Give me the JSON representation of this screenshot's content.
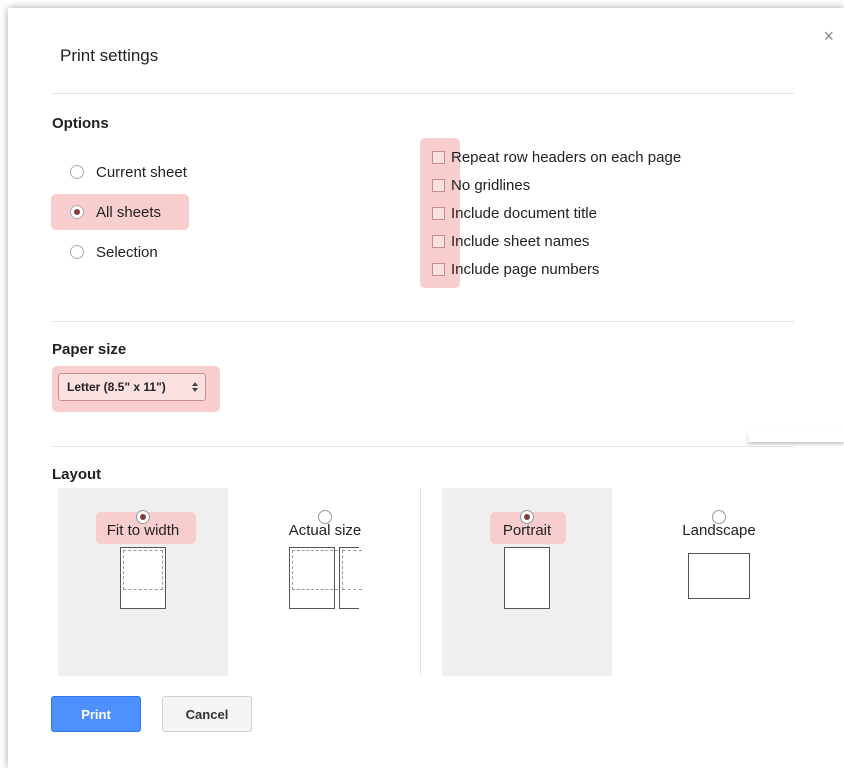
{
  "dialog": {
    "title": "Print settings",
    "close_glyph": "×"
  },
  "options": {
    "heading": "Options",
    "scope": [
      {
        "label": "Current sheet",
        "checked": false
      },
      {
        "label": "All sheets",
        "checked": true
      },
      {
        "label": "Selection",
        "checked": false
      }
    ],
    "checkboxes": [
      {
        "label": "Repeat row headers on each page",
        "checked": false
      },
      {
        "label": "No gridlines",
        "checked": false
      },
      {
        "label": "Include document title",
        "checked": false
      },
      {
        "label": "Include sheet names",
        "checked": false
      },
      {
        "label": "Include page numbers",
        "checked": false
      }
    ]
  },
  "paper": {
    "heading": "Paper size",
    "selected": "Letter (8.5\" x 11\")"
  },
  "layout": {
    "heading": "Layout",
    "scale": [
      {
        "label": "Fit to width",
        "checked": true
      },
      {
        "label": "Actual size",
        "checked": false
      }
    ],
    "orientation": [
      {
        "label": "Portrait",
        "checked": true
      },
      {
        "label": "Landscape",
        "checked": false
      }
    ]
  },
  "buttons": {
    "print": "Print",
    "cancel": "Cancel"
  },
  "colors": {
    "highlight": "#f7c9c9",
    "primary": "#4d90fe",
    "selected_panel": "#efefef"
  }
}
